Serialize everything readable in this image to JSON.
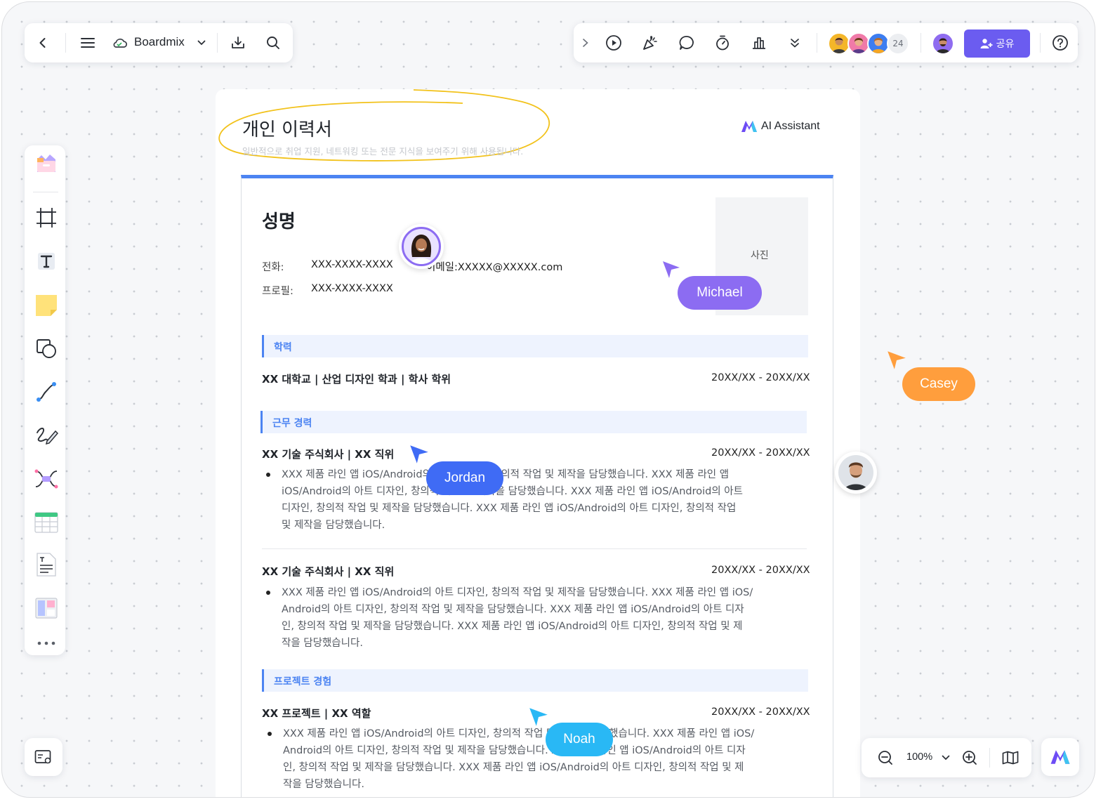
{
  "toolbar": {
    "brand": "Boardmix",
    "share_label": "공유",
    "collab_count": "24"
  },
  "doc": {
    "title": "개인 이력서",
    "subtitle": "일반적으로 취업 지원, 네트워킹 또는 전문 지식을 보여주기 위해 사용됩니다.",
    "ai_label": "AI Assistant"
  },
  "resume": {
    "name": "성명",
    "photo_label": "사진",
    "phone_label": "전화:",
    "phone_value": "XXX-XXXX-XXXX",
    "email_value": "이메일:XXXXX@XXXXX.com",
    "profile_label": "프로필:",
    "profile_value": "XXX-XXXX-XXXX",
    "sections": {
      "education": "학력",
      "work": "근무 경력",
      "project": "프로젝트 경험"
    },
    "education_row": {
      "title": "XX 대학교 | 산업 디자인 학과 | 학사 학위",
      "date": "20XX/XX - 20XX/XX"
    },
    "work1": {
      "title": "XX 기술 주식회사 | XX 직위",
      "date": "20XX/XX - 20XX/XX",
      "lines": [
        "XXX 제품 라인 앱 iOS/Android의 아트 디자인, 창의적 작업 및 제작을 담당했습니다. XXX 제품 라인 앱",
        "iOS/Android의 아트 디자인, 창의적 작업 및 제작을 담당했습니다. XXX 제품 라인 앱 iOS/Android의 아트",
        "디자인, 창의적 작업 및 제작을 담당했습니다. XXX 제품 라인 앱 iOS/Android의 아트 디자인, 창의적 작업",
        "및 제작을 담당했습니다."
      ]
    },
    "work2": {
      "title": "XX 기술 주식회사 | XX 직위",
      "date": "20XX/XX - 20XX/XX",
      "lines": [
        "XXX 제품 라인 앱 iOS/Android의 아트 디자인, 창의적 작업 및 제작을 담당했습니다. XXX 제품 라인 앱 iOS/",
        "Android의 아트 디자인, 창의적 작업 및 제작을 담당했습니다. XXX 제품 라인 앱 iOS/Android의 아트 디자",
        "인, 창의적 작업 및 제작을 담당했습니다. XXX 제품 라인 앱 iOS/Android의 아트 디자인, 창의적 작업 및 제",
        "작을 담당했습니다."
      ]
    },
    "project1": {
      "title": "XX 프로젝트 | XX 역할",
      "date": "20XX/XX - 20XX/XX",
      "lines": [
        "XXX 제품 라인 앱 iOS/Android의 아트 디자인, 창의적 작업 및 제작을 담당했습니다. XXX 제품 라인 앱 iOS/",
        "Android의 아트 디자인, 창의적 작업 및 제작을 담당했습니다. XXX 제품 라인 앱 iOS/Android의 아트 디자",
        "인, 창의적 작업 및 제작을 담당했습니다. XXX 제품 라인 앱 iOS/Android의 아트 디자인, 창의적 작업 및 제",
        "작을 담당했습니다."
      ]
    }
  },
  "collaborators": {
    "michael": "Michael",
    "casey": "Casey",
    "jordan": "Jordan",
    "noah": "Noah"
  },
  "zoom": {
    "level": "100%"
  },
  "colors": {
    "accent": "#6b5cf0",
    "blue": "#4c84f2",
    "michael": "#8c6cf2",
    "casey": "#ff9e3d",
    "jordan": "#3f6bf5",
    "noah": "#29b8f5",
    "highlight": "#f2c21b"
  },
  "icons": {
    "back": "chevron-left-icon",
    "menu": "hamburger-icon",
    "cloud": "cloud-icon",
    "download": "download-icon",
    "search": "search-icon",
    "play": "play-icon",
    "celebrate": "party-icon",
    "comment": "comment-icon",
    "timer": "timer-icon",
    "vote": "vote-icon",
    "more": "double-chevron-down-icon",
    "help": "help-icon"
  }
}
